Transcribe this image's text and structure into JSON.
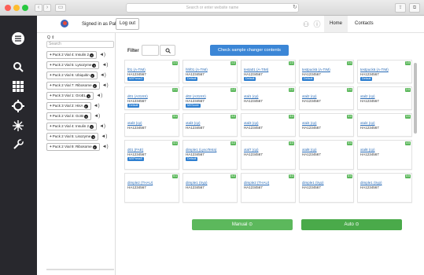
{
  "browser": {
    "address_placeholder": "Search or enter website name"
  },
  "header": {
    "signed_in": "Signed in as Pabxi",
    "logout_label": "Log out",
    "tabs": {
      "home": "Home",
      "contacts": "Contacts"
    }
  },
  "sidebar": {
    "icons": [
      "menu-icon",
      "search-icon",
      "grid-icon",
      "settings-icon",
      "sample-icon",
      "tools-icon"
    ]
  },
  "puck_panel": {
    "sort_glyph": "Q ⇕",
    "search_placeholder": "Search",
    "items": [
      {
        "label": "Puck 2 Vial 4: Insulin 2"
      },
      {
        "label": "Puck 2 Vial 5: Lysozyme"
      },
      {
        "label": "Puck 2 Vial 6: Ubiquitin"
      },
      {
        "label": "Puck 2 Vial 7: Ribosome"
      },
      {
        "label": "Puck 3 Vial 1: GroEL"
      },
      {
        "label": "Puck 3 Vial 2: HisA"
      },
      {
        "label": "Puck 2 Vial 3: GcIB"
      },
      {
        "label": "Puck 2 Vial 4: Insulin 2"
      },
      {
        "label": "Puck 2 Vial 5: Lisozyme"
      },
      {
        "label": "Puck 2 Vial 9: Ribosome"
      }
    ]
  },
  "filter": {
    "label": "Filter",
    "check_button": "Check sample changer contents"
  },
  "samples": [
    [
      {
        "num": "1:1",
        "name": "f01 (A-TIM)",
        "code": "HA1234567",
        "badge": "MXPressO"
      },
      {
        "num": "1:2",
        "name": "hhf01 (A-TIM)",
        "code": "HA1234567",
        "badge": "Default"
      },
      {
        "num": "1:3",
        "name": "testa01 (A-TIM)",
        "code": "HA1234567",
        "badge": "Default"
      },
      {
        "num": "1:4",
        "name": "testpuck6 (A-TIM)",
        "code": "HA1234567",
        "badge": "Default"
      },
      {
        "num": "1:5",
        "name": "testpuck6 (A-TIM)",
        "code": "HA1234567",
        "badge": "Default"
      }
    ],
    [
      {
        "num": "2:1",
        "name": "d01 (A31SS)",
        "code": "HA1234567",
        "badge": "Default"
      },
      {
        "num": "2:2",
        "name": "d02 (A31SS)",
        "code": "HA1234567",
        "badge": "MXScore"
      },
      {
        "num": "2:3",
        "name": "xtal1 (cp)",
        "code": "HA1234567",
        "badge": ""
      },
      {
        "num": "2:4",
        "name": "xtal2 (cp)",
        "code": "HA1234567",
        "badge": ""
      },
      {
        "num": "2:5",
        "name": "xtal2 (cp)",
        "code": "HA1234567",
        "badge": ""
      }
    ],
    [
      {
        "num": "3:1",
        "name": "xtal3 (cp)",
        "code": "HA1234567",
        "badge": ""
      },
      {
        "num": "3:2",
        "name": "xtal3 (cp)",
        "code": "HA1234567",
        "badge": ""
      },
      {
        "num": "3:3",
        "name": "xtal3 (cp)",
        "code": "HA1234567",
        "badge": ""
      },
      {
        "num": "3:4",
        "name": "xtal4 (cp)",
        "code": "HA1234567",
        "badge": ""
      },
      {
        "num": "3:5",
        "name": "xtal4 (cp)",
        "code": "HA1234567",
        "badge": ""
      }
    ],
    [
      {
        "num": "4:1",
        "name": "d01 (FAE)",
        "code": "HA1234567",
        "badge": "MXPressE"
      },
      {
        "num": "4:2",
        "name": "dimple1 (LysoTetra)",
        "code": "HA1234567",
        "badge": "Default"
      },
      {
        "num": "4:3",
        "name": "xtal7 (cp)",
        "code": "HA1234567",
        "badge": ""
      },
      {
        "num": "4:4",
        "name": "xtal8 (cp)",
        "code": "HA1234567",
        "badge": ""
      },
      {
        "num": "4:5",
        "name": "xtal8 (cp)",
        "code": "HA1234567",
        "badge": ""
      }
    ],
    [
      {
        "num": "5:1",
        "name": "dimple2 (THAU)",
        "code": "HA1234567",
        "badge": ""
      },
      {
        "num": "5:2",
        "name": "dimple1 (tryp)",
        "code": "HA1234567",
        "badge": ""
      },
      {
        "num": "5:3",
        "name": "dimple2 (THAU)",
        "code": "HA1234567",
        "badge": ""
      },
      {
        "num": "5:4",
        "name": "dimple1 (tryp)",
        "code": "HA1234567",
        "badge": ""
      },
      {
        "num": "5:5",
        "name": "dimple1 (tryp)",
        "code": "HA1234567",
        "badge": ""
      }
    ]
  ],
  "actions": {
    "manual": "Manual ⊙",
    "auto": "Auto ⊙"
  },
  "colors": {
    "accent_blue": "#3b86d6",
    "success_green": "#5cb85c",
    "sidebar_dark": "#28282d"
  }
}
